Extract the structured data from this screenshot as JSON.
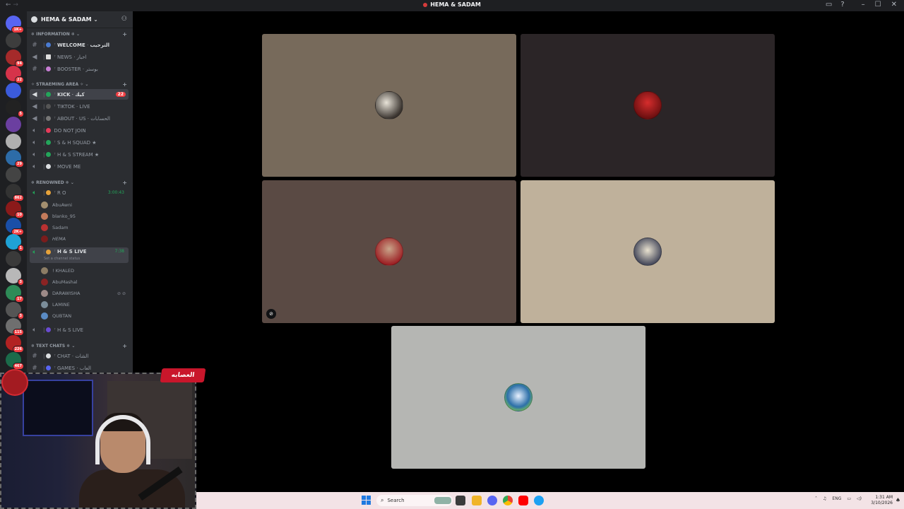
{
  "window": {
    "title": "HEMA & SADAM",
    "nav_back": "←",
    "nav_fwd": "→",
    "minimize": "–",
    "maximize": "☐",
    "close": "✕"
  },
  "server_rail": {
    "badges": [
      "1K+",
      "",
      "94",
      "22",
      "",
      "5",
      "",
      "",
      "29",
      "",
      "862",
      "10",
      "2K+",
      "1",
      "",
      "3",
      "17",
      "3",
      "115",
      "226",
      "467"
    ]
  },
  "guild": {
    "name": "HEMA & SADAM"
  },
  "categories": {
    "information": "INFORMATION",
    "streaming": "STRAEMING AREA",
    "renowned": "RENOWNED",
    "text": "TEXT CHATS"
  },
  "channels": {
    "welcome": {
      "name": "WELCOME",
      "ar": "الترحيب"
    },
    "news": {
      "name": "NEWS",
      "ar": "اخبار"
    },
    "booster": {
      "name": "BOOSTER",
      "ar": "بوستر"
    },
    "kick": {
      "name": "KICK",
      "ar": "كيك",
      "count": "22"
    },
    "tiktok": {
      "name": "TIKTOK · LIVE"
    },
    "about": {
      "name": "ABOUT · US",
      "ar": "الحسابات"
    },
    "donotjoin": {
      "name": "DO NOT JOIN"
    },
    "squad": {
      "name": "S & H SQUAD ★"
    },
    "stream": {
      "name": "H & S STREAM ★"
    },
    "moveme": {
      "name": "MOVE ME"
    },
    "ro": {
      "name": "R O",
      "timer": "3:00:43"
    },
    "hslive": {
      "name": "H & S LIVE",
      "timer": "7:38",
      "status": "Set a channel status"
    },
    "hslive2": {
      "name": "H & S LIVE"
    },
    "chat": {
      "name": "CHAT",
      "ar": "الشات"
    },
    "games": {
      "name": "GAMES",
      "ar": "العاب"
    }
  },
  "members_ro": [
    "AbuAwni",
    "blanko_95",
    "Sadam",
    "HEMA"
  ],
  "members_live": [
    "! KHALED",
    "AbuMashal",
    "DARAWISHA",
    "LAMINE",
    "QUBTAN"
  ],
  "taskbar": {
    "search_placeholder": "Search",
    "lang": "ENG",
    "time": "1:31 AM",
    "date": "3/10/2026"
  },
  "webcam": {
    "logo_text": "العصابه"
  },
  "colors": {
    "tile1": "#776a5b",
    "tile2": "#2b2527",
    "tile3": "#5a4a44",
    "tile4": "#bfb19b",
    "tile5": "#b5b6b3",
    "accent_green": "#23a55a",
    "badge_red": "#f23f43"
  }
}
